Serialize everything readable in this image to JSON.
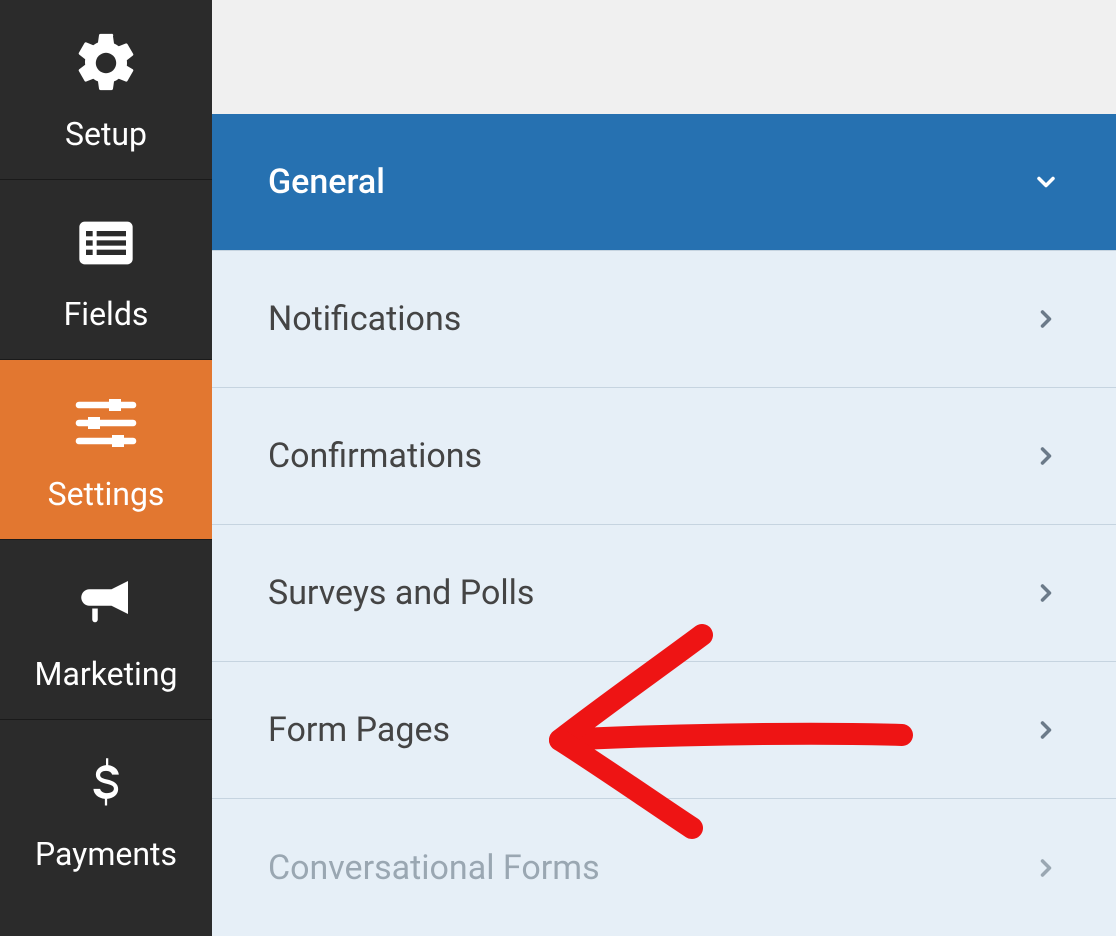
{
  "sidebar": {
    "items": [
      {
        "label": "Setup"
      },
      {
        "label": "Fields"
      },
      {
        "label": "Settings"
      },
      {
        "label": "Marketing"
      },
      {
        "label": "Payments"
      }
    ]
  },
  "settings": {
    "panels": [
      {
        "label": "General"
      },
      {
        "label": "Notifications"
      },
      {
        "label": "Confirmations"
      },
      {
        "label": "Surveys and Polls"
      },
      {
        "label": "Form Pages"
      },
      {
        "label": "Conversational Forms"
      }
    ]
  }
}
